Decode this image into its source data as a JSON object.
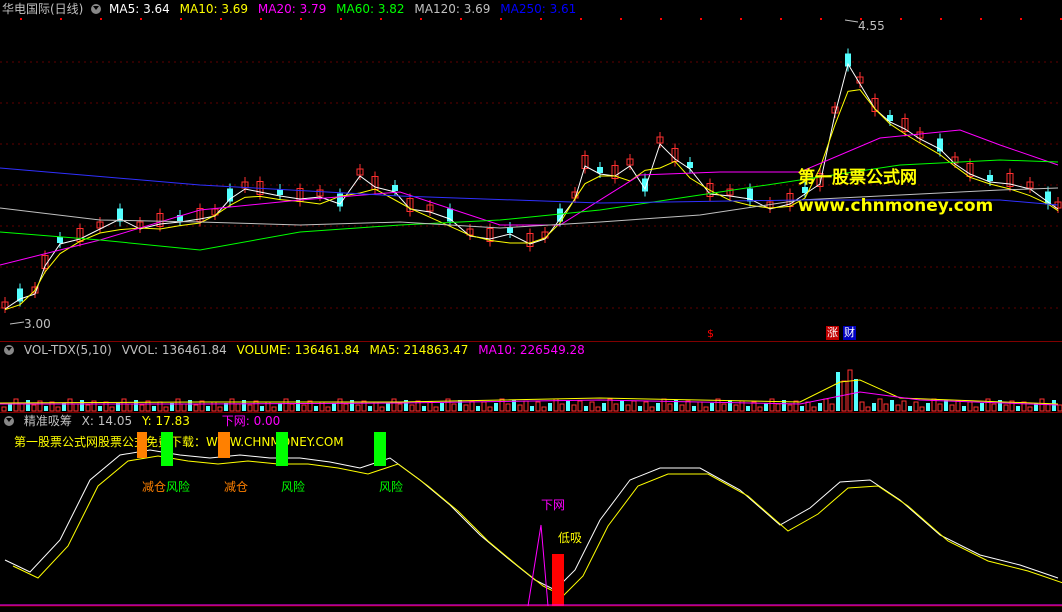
{
  "main": {
    "title": "华电国际(日线)",
    "ma": [
      {
        "label": "MA5: 3.64",
        "color": "#ffffff"
      },
      {
        "label": "MA10: 3.69",
        "color": "#ffff00"
      },
      {
        "label": "MA20: 3.79",
        "color": "#ff00ff"
      },
      {
        "label": "MA60: 3.82",
        "color": "#00ff00"
      },
      {
        "label": "MA120: 3.69",
        "color": "#c0c0c0"
      },
      {
        "label": "MA250: 3.61",
        "color": "#0000ff"
      }
    ],
    "high_label": "4.55",
    "low_label": "3.00",
    "marker_s": "$",
    "marker_zhang": "涨",
    "marker_cai": "财"
  },
  "volume": {
    "items": [
      {
        "label": "VOL-TDX(5,10)",
        "color": "#c0c0c0"
      },
      {
        "label": "VVOL: 136461.84",
        "color": "#c0c0c0"
      },
      {
        "label": "VOLUME: 136461.84",
        "color": "#ffff00"
      },
      {
        "label": "MA5: 214863.47",
        "color": "#ffff00"
      },
      {
        "label": "MA10: 226549.28",
        "color": "#ff00ff"
      }
    ]
  },
  "indicator": {
    "name": "精准吸筹",
    "x": "X: 14.05",
    "y": "Y: 17.83",
    "xiawang": "下网: 0.00",
    "promo": "第一股票公式网股票公式免费下载：WWW.CHNMONEY.COM",
    "labels": {
      "jiancang1": "减仓",
      "fengxian1": "风险",
      "jiancang2": "减仓",
      "fengxian2": "风险",
      "fengxian3": "风险",
      "xiawang": "下网",
      "dixi": "低吸"
    }
  },
  "watermark": {
    "line1": "第一股票公式网",
    "line2": "www.chnmoney.com"
  }
}
